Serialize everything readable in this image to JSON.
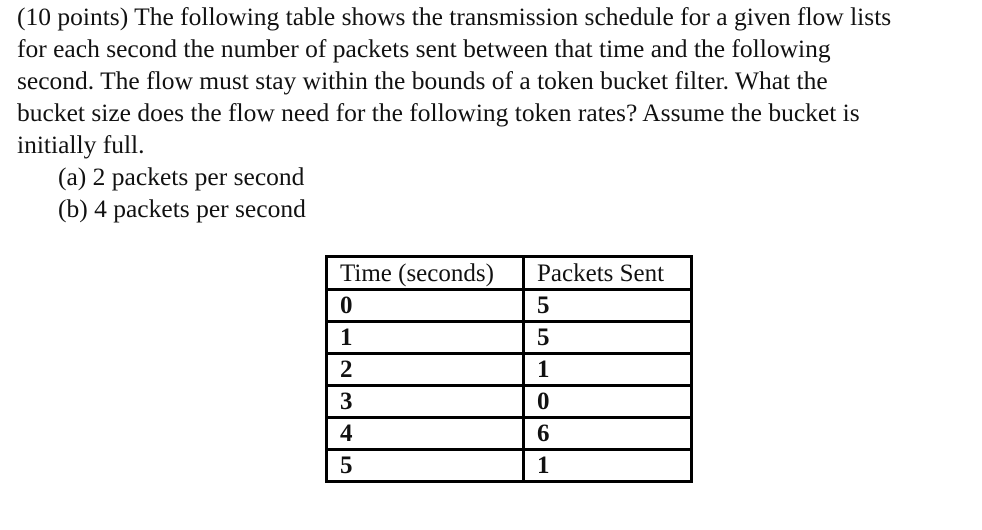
{
  "question": {
    "lines": [
      "(10 points) The following table shows the transmission schedule for a given flow lists",
      "for each second the number of packets sent between that time and the following",
      "second.  The flow must stay within the bounds of a token bucket filter.  What the",
      "bucket size does the flow need for the following token rates?  Assume the bucket is",
      "initially full."
    ],
    "options": [
      "(a) 2 packets per second",
      "(b) 4 packets per second"
    ]
  },
  "table": {
    "headers": [
      "Time (seconds)",
      "Packets Sent"
    ],
    "rows": [
      [
        "0",
        "5"
      ],
      [
        "1",
        "5"
      ],
      [
        "2",
        "1"
      ],
      [
        "3",
        "0"
      ],
      [
        "4",
        "6"
      ],
      [
        "5",
        "1"
      ]
    ]
  }
}
